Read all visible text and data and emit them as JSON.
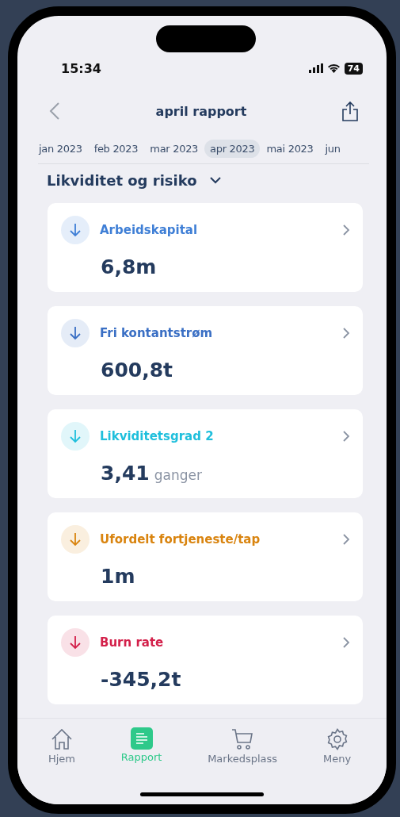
{
  "status_bar": {
    "time": "15:34",
    "battery": "74"
  },
  "nav": {
    "title": "april rapport"
  },
  "months": [
    {
      "label": "jan 2023",
      "selected": false
    },
    {
      "label": "feb 2023",
      "selected": false
    },
    {
      "label": "mar 2023",
      "selected": false
    },
    {
      "label": "apr 2023",
      "selected": true
    },
    {
      "label": "mai 2023",
      "selected": false
    },
    {
      "label": "jun",
      "selected": false
    }
  ],
  "section": {
    "title": "Likviditet og risiko",
    "expanded": true
  },
  "cards": [
    {
      "title": "Arbeidskapital",
      "value": "6,8m",
      "color": "#3f7fd6"
    },
    {
      "title": "Fri kontantstrøm",
      "value": "600,8t",
      "color": "#3a6fc4"
    },
    {
      "title": "Likviditetsgrad 2",
      "value": "3,41",
      "unit": "ganger",
      "color": "#1fbfdc"
    },
    {
      "title": "Ufordelt fortjeneste/tap",
      "value": "1m",
      "color": "#d9840f"
    },
    {
      "title": "Burn rate",
      "value": "-345,2t",
      "color": "#d3204a"
    }
  ],
  "tab_bar": [
    {
      "label": "Hjem",
      "kind": "home",
      "selected": false
    },
    {
      "label": "Rapport",
      "kind": "report",
      "selected": true
    },
    {
      "label": "Markedsplass",
      "kind": "cart",
      "selected": false
    },
    {
      "label": "Meny",
      "kind": "gear",
      "selected": false
    }
  ]
}
